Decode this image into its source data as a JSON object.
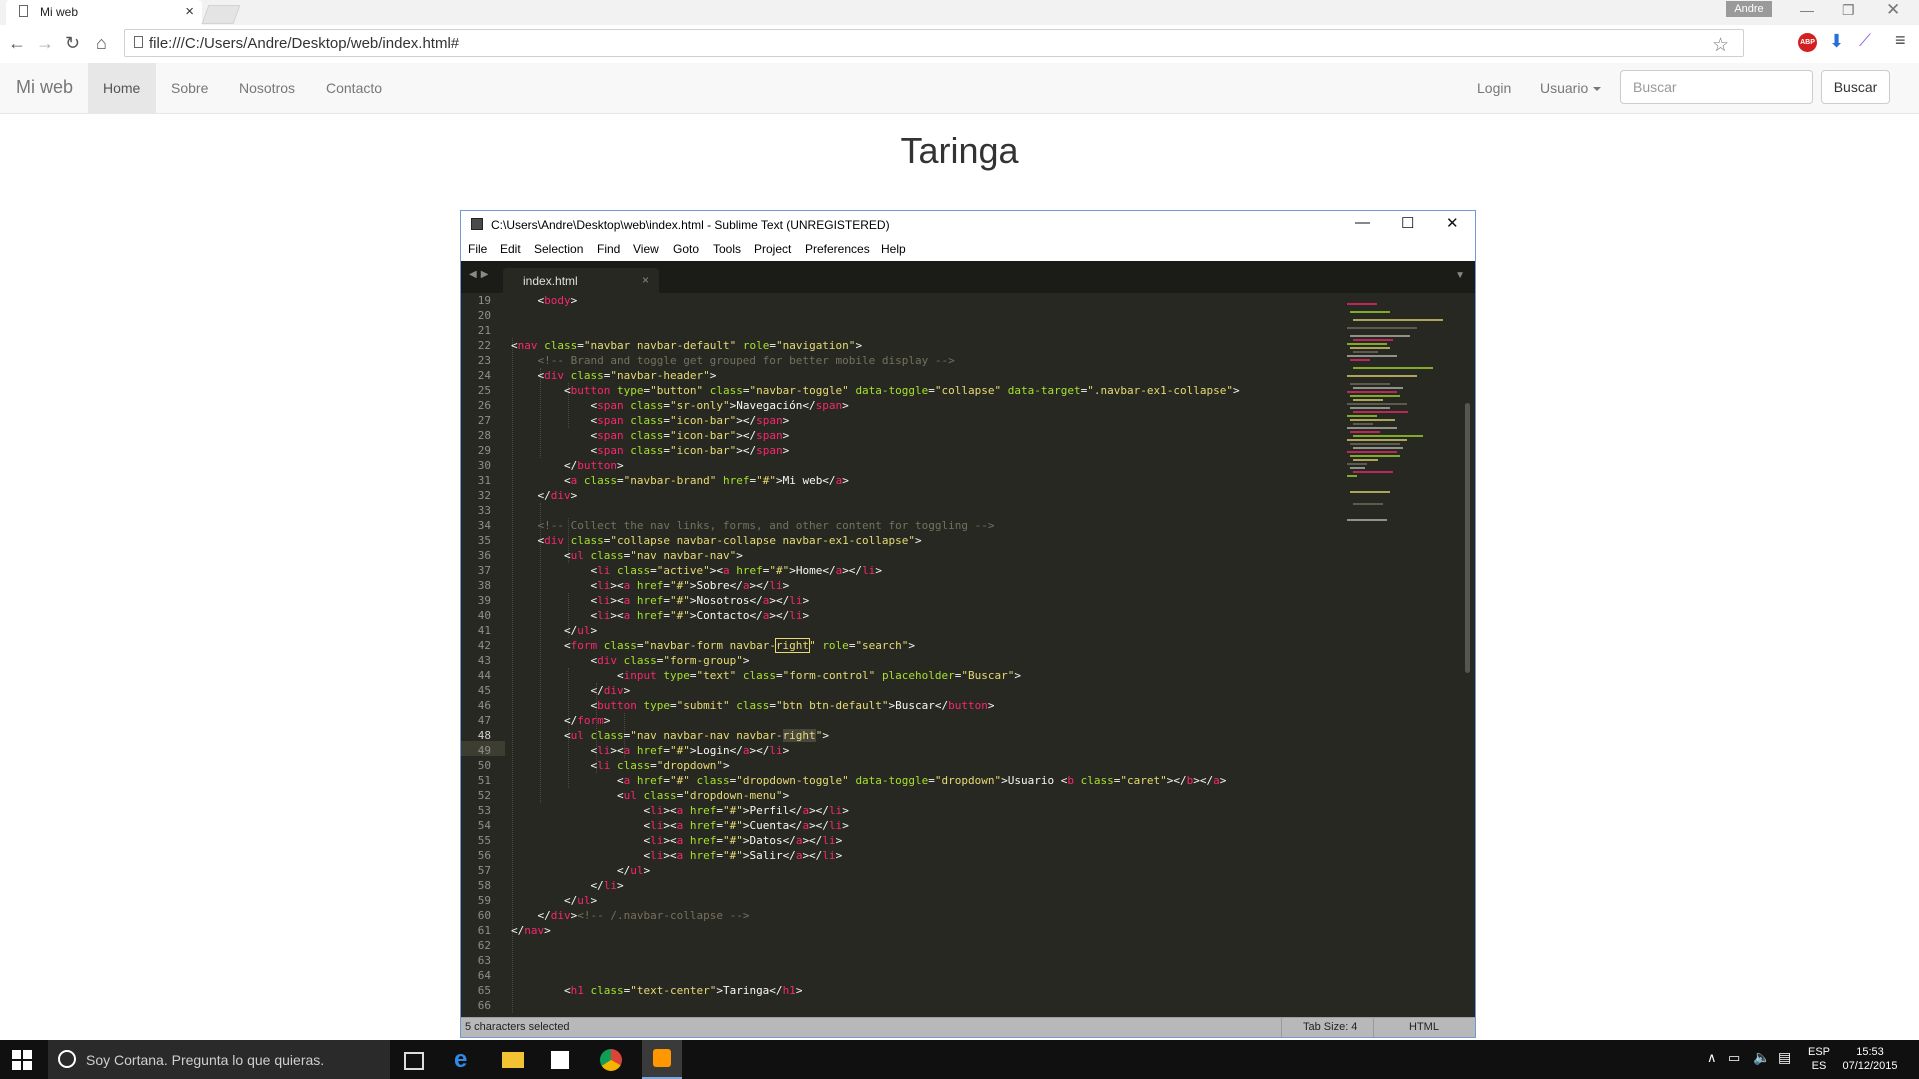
{
  "browser": {
    "tab_title": "Mi web",
    "tab_close": "×",
    "user_badge": "Andre",
    "url": "file:///C:/Users/Andre/Desktop/web/index.html#",
    "ext_abp": "ABP"
  },
  "site": {
    "brand": "Mi web",
    "nav": [
      "Home",
      "Sobre",
      "Nosotros",
      "Contacto"
    ],
    "login": "Login",
    "usuario": "Usuario",
    "search_placeholder": "Buscar",
    "search_button": "Buscar",
    "heading": "Taringa"
  },
  "sublime": {
    "title": "C:\\Users\\Andre\\Desktop\\web\\index.html - Sublime Text (UNREGISTERED)",
    "menu": [
      "File",
      "Edit",
      "Selection",
      "Find",
      "View",
      "Goto",
      "Tools",
      "Project",
      "Preferences",
      "Help"
    ],
    "tab": "index.html",
    "status_left": "5 characters selected",
    "tab_size": "Tab Size: 4",
    "syntax": "HTML",
    "current_line": 48,
    "line_numbers": [
      19,
      20,
      21,
      22,
      23,
      24,
      25,
      26,
      27,
      28,
      29,
      30,
      31,
      32,
      33,
      34,
      35,
      36,
      37,
      38,
      39,
      40,
      41,
      42,
      43,
      44,
      45,
      46,
      47,
      48,
      49,
      50,
      51,
      52,
      53,
      54,
      55,
      56,
      57,
      58,
      59,
      60,
      61,
      62,
      63,
      64,
      65,
      66
    ]
  },
  "taskbar": {
    "cortana": "Soy Cortana. Pregunta lo que quieras.",
    "lang_top": "ESP",
    "lang_bottom": "ES",
    "time": "15:53",
    "date": "07/12/2015"
  },
  "colors": {
    "editor_bg": "#272822",
    "tag": "#f92672",
    "attr": "#a6e22e",
    "string": "#e6db74",
    "comment": "#75715e",
    "navbar_bg": "#f8f8f8"
  }
}
